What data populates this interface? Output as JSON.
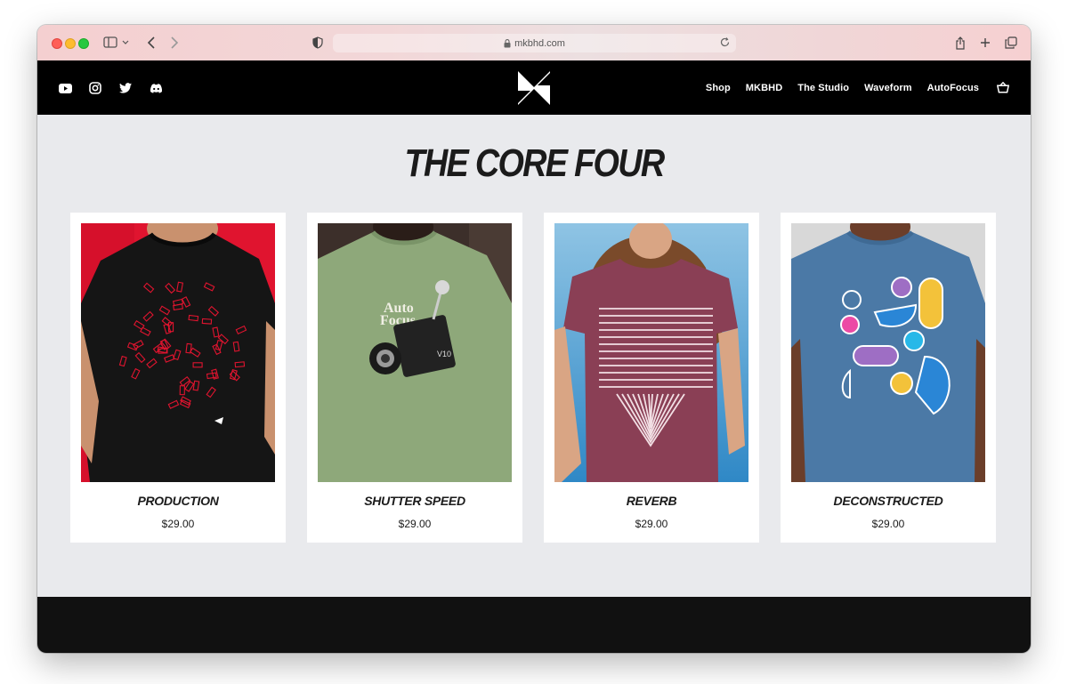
{
  "browser": {
    "url": "mkbhd.com"
  },
  "header": {
    "social_icons": [
      "youtube-icon",
      "instagram-icon",
      "twitter-icon",
      "discord-icon"
    ],
    "nav": [
      "Shop",
      "MKBHD",
      "The Studio",
      "Waveform",
      "AutoFocus"
    ]
  },
  "main": {
    "heading": "THE CORE FOUR",
    "products": [
      {
        "name": "PRODUCTION",
        "price": "$29.00"
      },
      {
        "name": "SHUTTER SPEED",
        "price": "$29.00"
      },
      {
        "name": "REVERB",
        "price": "$29.00"
      },
      {
        "name": "DECONSTRUCTED",
        "price": "$29.00"
      }
    ]
  },
  "colors": {
    "header_bg": "#000000",
    "page_bg": "#e9eaed",
    "footer_bg": "#111111",
    "titlebar_tint": "#f2d3d4"
  }
}
